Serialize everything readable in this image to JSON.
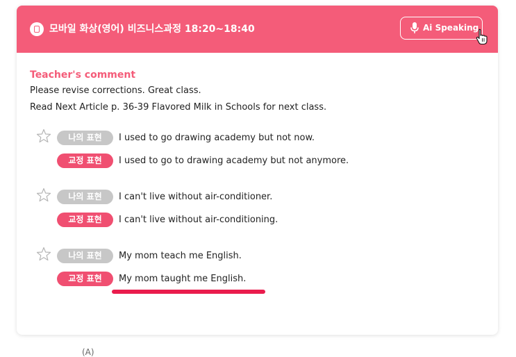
{
  "header": {
    "title": "모바일 화상(영어) 비즈니스과정 18:20~18:40",
    "speak_button_label": "Ai Speaking",
    "class_icon": "class-icon",
    "mic_icon": "microphone-icon",
    "cursor_icon": "hand-pointer-icon"
  },
  "comment": {
    "title": "Teacher's comment",
    "lines": [
      "Please revise corrections. Great class.",
      "Read Next Article p. 36-39 Flavored Milk in Schools for next class."
    ]
  },
  "corrections": [
    {
      "mine_label": "나의 표현",
      "mine": "I used to go drawing academy but not now.",
      "fix_label": "교정 표현",
      "fix": "I used to go to drawing academy but not anymore."
    },
    {
      "mine_label": "나의 표현",
      "mine": "I can't live without air-conditioner.",
      "fix_label": "교정 표현",
      "fix": "I can't live without air-conditioning."
    },
    {
      "mine_label": "나의 표현",
      "mine": "My mom teach me English.",
      "fix_label": "교정 표현",
      "fix": "My mom taught me English."
    }
  ],
  "below_text": "(A)",
  "colors": {
    "accent": "#f45c79",
    "fix_tag": "#f04f71",
    "mine_tag": "#c7c7c7",
    "underline": "#ea1c4d"
  }
}
